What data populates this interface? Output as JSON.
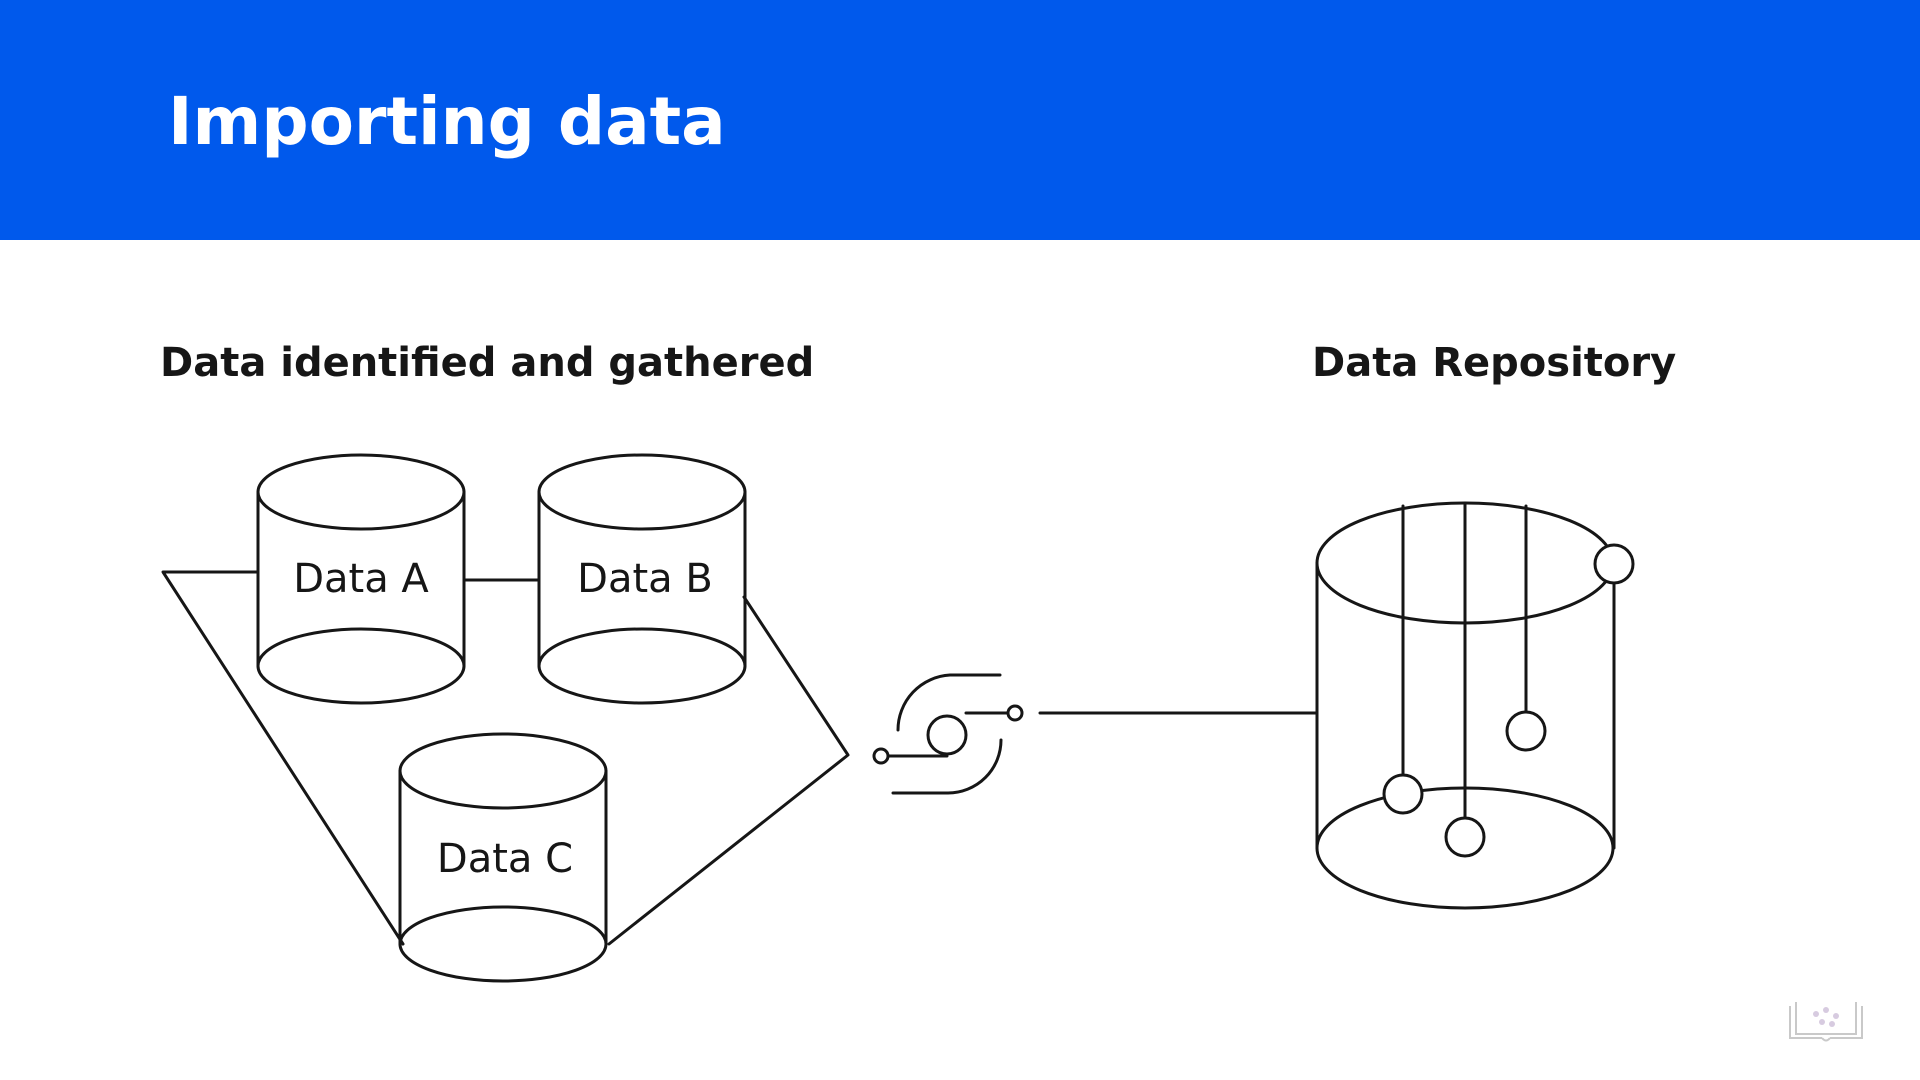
{
  "slide": {
    "title": "Importing data",
    "header_color": "#0059ec"
  },
  "left_section": {
    "heading": "Data identified and gathered",
    "sources": [
      {
        "label": "Data A"
      },
      {
        "label": "Data B"
      },
      {
        "label": "Data C"
      }
    ]
  },
  "right_section": {
    "heading": "Data Repository"
  },
  "icons": {
    "connector": "data-pipeline-connector-icon",
    "watermark": "course-watermark-icon"
  }
}
